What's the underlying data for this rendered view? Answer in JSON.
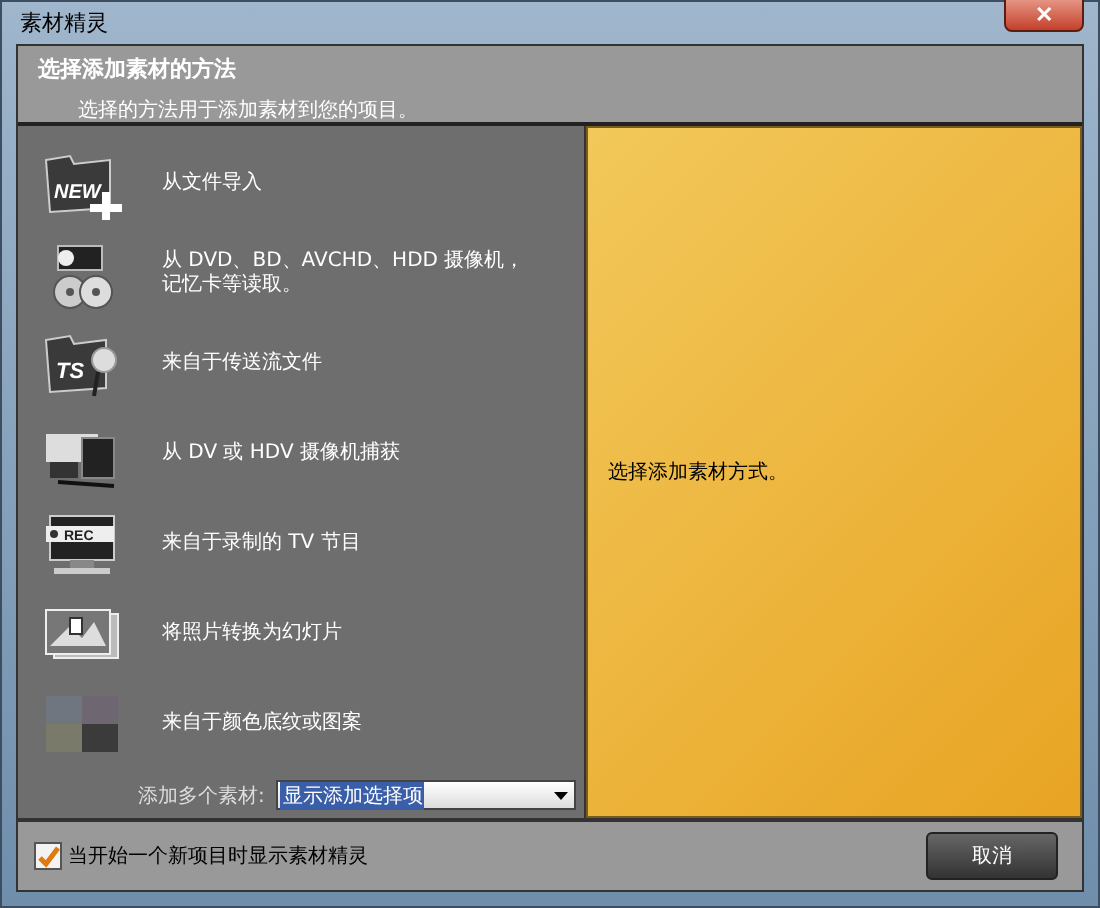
{
  "window": {
    "title": "素材精灵",
    "close": "✕"
  },
  "header": {
    "title": "选择添加素材的方法",
    "subtitle": "选择的方法用于添加素材到您的项目。"
  },
  "methods": [
    {
      "kind": "folder",
      "badge": "NEW",
      "label": "从文件导入"
    },
    {
      "kind": "discs",
      "label": "从 DVD、BD、AVCHD、HDD 摄像机，记忆卡等读取。"
    },
    {
      "kind": "folder-search",
      "badge": "TS",
      "label": "来自于传送流文件"
    },
    {
      "kind": "camcorder",
      "label": "从 DV 或 HDV 摄像机捕获"
    },
    {
      "kind": "tv",
      "badge": "REC",
      "label": "来自于录制的 TV 节目"
    },
    {
      "kind": "photos",
      "label": "将照片转换为幻灯片"
    },
    {
      "kind": "swatches",
      "label": "来自于颜色底纹或图案"
    }
  ],
  "multi_add": {
    "label": "添加多个素材:",
    "value": "显示添加选择项"
  },
  "preview": {
    "text": "选择添加素材方式。"
  },
  "footer": {
    "checkbox": {
      "label": "当开始一个新项目时显示素材精灵",
      "checked": true
    },
    "cancel": "取消"
  }
}
